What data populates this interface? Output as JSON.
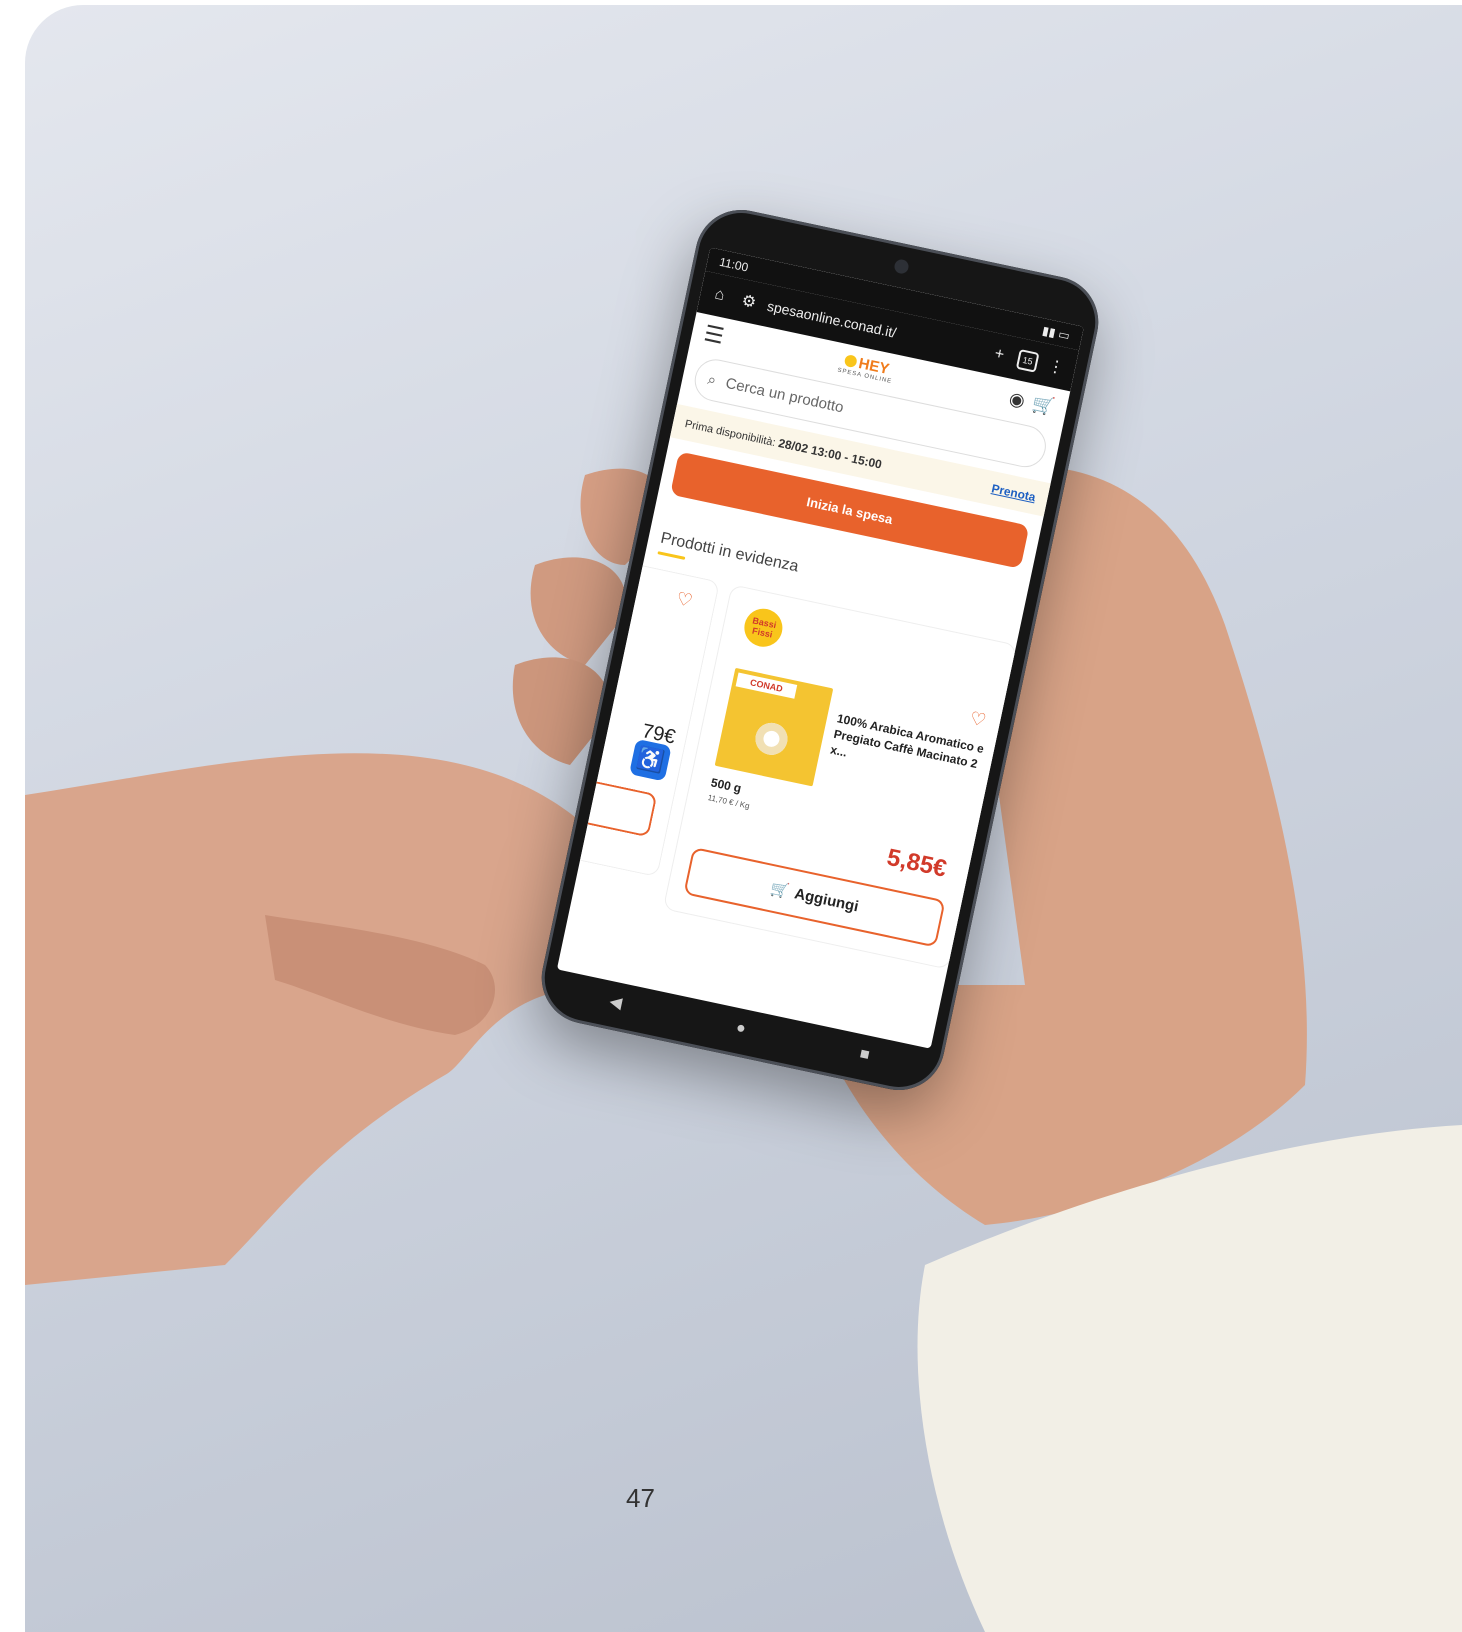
{
  "status_bar": {
    "time": "11:00",
    "bell_icon": "bell-off-icon",
    "signal": "signal-battery-icon"
  },
  "browser": {
    "url": "spesaonline.conad.it/",
    "tab_count": "15"
  },
  "logo": {
    "main": "HEY",
    "sub": "SPESA ONLINE"
  },
  "search": {
    "placeholder": "Cerca un prodotto"
  },
  "availability": {
    "label": "Prima disponibilità:",
    "value": "28/02 13:00 - 15:00",
    "link": "Prenota"
  },
  "cta": {
    "label": "Inizia la spesa"
  },
  "section": {
    "title": "Prodotti in evidenza"
  },
  "prev_card": {
    "price": "79€"
  },
  "product": {
    "badge": "Bassi Fissi",
    "brand": "CONAD",
    "name": "100% Arabica Aromatico e Pregiato Caffè Macinato 2 x...",
    "weight": "500 g",
    "price_per_kg": "11,70 € / Kg",
    "price": "5,85€",
    "add_label": "Aggiungi"
  },
  "page_number": "47",
  "colors": {
    "accent": "#e8622c",
    "price": "#d13a2a",
    "link": "#1d5fc2",
    "highlight": "#f9c51b"
  }
}
